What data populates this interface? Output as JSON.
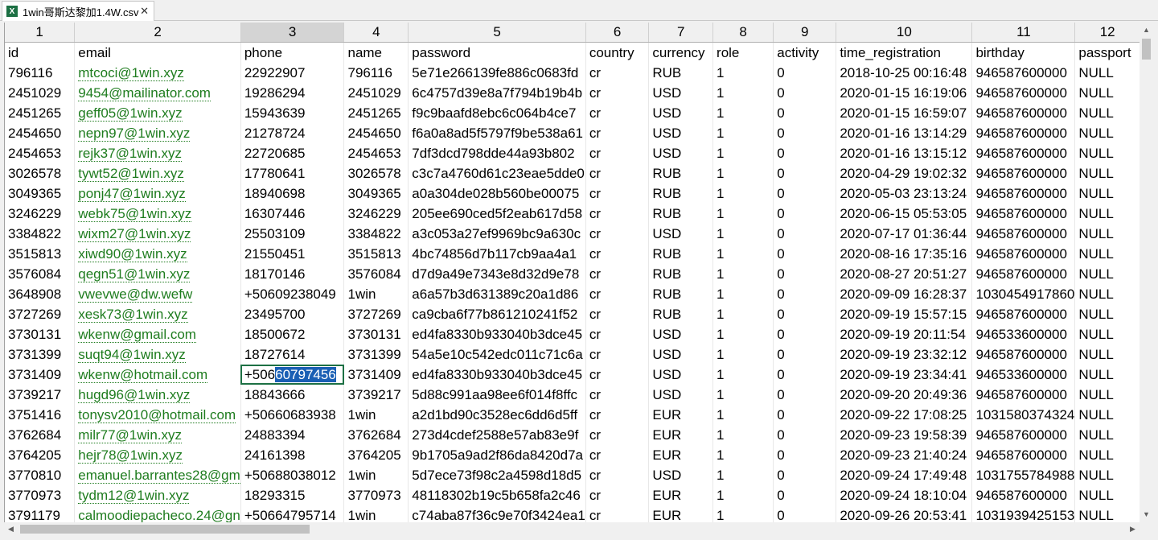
{
  "tab": {
    "title": "1win哥斯达黎加1.4W.csv",
    "close": "✕",
    "icon": "X"
  },
  "columns": [
    "1",
    "2",
    "3",
    "4",
    "5",
    "6",
    "7",
    "8",
    "9",
    "10",
    "11",
    "12"
  ],
  "header": [
    "id",
    "email",
    "phone",
    "name",
    "password",
    "country",
    "currency",
    "role",
    "activity",
    "time_registration",
    "birthday",
    "passport"
  ],
  "rows": [
    [
      "796116",
      "mtcoci@1win.xyz",
      "22922907",
      "796116",
      "5e71e266139fe886c0683fd",
      "cr",
      "RUB",
      "1",
      "0",
      "2018-10-25 00:16:48",
      "946587600000",
      "NULL"
    ],
    [
      "2451029",
      "9454@mailinator.com",
      "19286294",
      "2451029",
      "6c4757d39e8a7f794b19b4b",
      "cr",
      "USD",
      "1",
      "0",
      "2020-01-15 16:19:06",
      "946587600000",
      "NULL"
    ],
    [
      "2451265",
      "geff05@1win.xyz",
      "15943639",
      "2451265",
      "f9c9baafd8ebc6c064b4ce7",
      "cr",
      "USD",
      "1",
      "0",
      "2020-01-15 16:59:07",
      "946587600000",
      "NULL"
    ],
    [
      "2454650",
      "nepn97@1win.xyz",
      "21278724",
      "2454650",
      "f6a0a8ad5f5797f9be538a61",
      "cr",
      "USD",
      "1",
      "0",
      "2020-01-16 13:14:29",
      "946587600000",
      "NULL"
    ],
    [
      "2454653",
      "rejk37@1win.xyz",
      "22720685",
      "2454653",
      "7df3dcd798dde44a93b802",
      "cr",
      "USD",
      "1",
      "0",
      "2020-01-16 13:15:12",
      "946587600000",
      "NULL"
    ],
    [
      "3026578",
      "tywt52@1win.xyz",
      "17780641",
      "3026578",
      "c3c7a4760d61c23eae5dde0",
      "cr",
      "RUB",
      "1",
      "0",
      "2020-04-29 19:02:32",
      "946587600000",
      "NULL"
    ],
    [
      "3049365",
      "ponj47@1win.xyz",
      "18940698",
      "3049365",
      "a0a304de028b560be00075",
      "cr",
      "RUB",
      "1",
      "0",
      "2020-05-03 23:13:24",
      "946587600000",
      "NULL"
    ],
    [
      "3246229",
      "webk75@1win.xyz",
      "16307446",
      "3246229",
      "205ee690ced5f2eab617d58",
      "cr",
      "RUB",
      "1",
      "0",
      "2020-06-15 05:53:05",
      "946587600000",
      "NULL"
    ],
    [
      "3384822",
      "wixm27@1win.xyz",
      "25503109",
      "3384822",
      "a3c053a27ef9969bc9a630c",
      "cr",
      "USD",
      "1",
      "0",
      "2020-07-17 01:36:44",
      "946587600000",
      "NULL"
    ],
    [
      "3515813",
      "xiwd90@1win.xyz",
      "21550451",
      "3515813",
      "4bc74856d7b117cb9aa4a1",
      "cr",
      "RUB",
      "1",
      "0",
      "2020-08-16 17:35:16",
      "946587600000",
      "NULL"
    ],
    [
      "3576084",
      "qegn51@1win.xyz",
      "18170146",
      "3576084",
      "d7d9a49e7343e8d32d9e78",
      "cr",
      "RUB",
      "1",
      "0",
      "2020-08-27 20:51:27",
      "946587600000",
      "NULL"
    ],
    [
      "3648908",
      "vwevwe@dw.wefw",
      "+50609238049",
      "1win",
      "a6a57b3d631389c20a1d86",
      "cr",
      "RUB",
      "1",
      "0",
      "2020-09-09 16:28:37",
      "1030454917860",
      "NULL"
    ],
    [
      "3727269",
      "xesk73@1win.xyz",
      "23495700",
      "3727269",
      "ca9cba6f77b861210241f52",
      "cr",
      "RUB",
      "1",
      "0",
      "2020-09-19 15:57:15",
      "946587600000",
      "NULL"
    ],
    [
      "3730131",
      "wkenw@gmail.com",
      "18500672",
      "3730131",
      "ed4fa8330b933040b3dce45",
      "cr",
      "USD",
      "1",
      "0",
      "2020-09-19 20:11:54",
      "946533600000",
      "NULL"
    ],
    [
      "3731399",
      "suqt94@1win.xyz",
      "18727614",
      "3731399",
      "54a5e10c542edc011c71c6a",
      "cr",
      "USD",
      "1",
      "0",
      "2020-09-19 23:32:12",
      "946587600000",
      "NULL"
    ],
    [
      "3731409",
      "wkenw@hotmail.com",
      "+50660797456",
      "3731409",
      "ed4fa8330b933040b3dce45",
      "cr",
      "USD",
      "1",
      "0",
      "2020-09-19 23:34:41",
      "946533600000",
      "NULL"
    ],
    [
      "3739217",
      "hugd96@1win.xyz",
      "18843666",
      "3739217",
      "5d88c991aa98ee6f014f8ffc",
      "cr",
      "USD",
      "1",
      "0",
      "2020-09-20 20:49:36",
      "946587600000",
      "NULL"
    ],
    [
      "3751416",
      "tonysv2010@hotmail.com",
      "+50660683938",
      "1win",
      "a2d1bd90c3528ec6dd6d5ff",
      "cr",
      "EUR",
      "1",
      "0",
      "2020-09-22 17:08:25",
      "1031580374324",
      "NULL"
    ],
    [
      "3762684",
      "milr77@1win.xyz",
      "24883394",
      "3762684",
      "273d4cdef2588e57ab83e9f",
      "cr",
      "EUR",
      "1",
      "0",
      "2020-09-23 19:58:39",
      "946587600000",
      "NULL"
    ],
    [
      "3764205",
      "hejr78@1win.xyz",
      "24161398",
      "3764205",
      "9b1705a9ad2f86da8420d7a",
      "cr",
      "EUR",
      "1",
      "0",
      "2020-09-23 21:40:24",
      "946587600000",
      "NULL"
    ],
    [
      "3770810",
      "emanuel.barrantes28@gm",
      "+50688038012",
      "1win",
      "5d7ece73f98c2a4598d18d5",
      "cr",
      "USD",
      "1",
      "0",
      "2020-09-24 17:49:48",
      "1031755784988",
      "NULL"
    ],
    [
      "3770973",
      "tydm12@1win.xyz",
      "18293315",
      "3770973",
      "48118302b19c5b658fa2c46",
      "cr",
      "EUR",
      "1",
      "0",
      "2020-09-24 18:10:04",
      "946587600000",
      "NULL"
    ],
    [
      "3791179",
      "calmoodiepacheco.24@gn",
      "+50664795714",
      "1win",
      "c74aba87f36c9e70f3424ea1",
      "cr",
      "EUR",
      "1",
      "0",
      "2020-09-26 20:53:41",
      "1031939425153",
      "NULL"
    ]
  ],
  "active_cell": {
    "row": 15,
    "col": 2,
    "prefix": "+506",
    "selected": "60797456"
  },
  "scroll": {
    "up": "▲",
    "down": "▼",
    "left": "◀",
    "right": "▶"
  }
}
